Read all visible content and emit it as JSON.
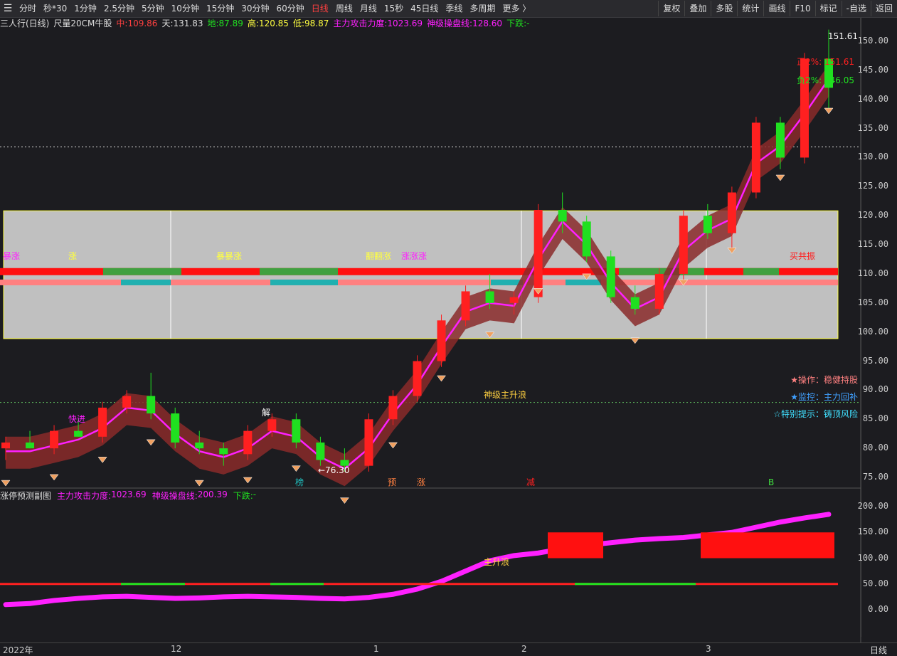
{
  "toolbar": {
    "items": [
      "分时",
      "秒*30",
      "1分钟",
      "2.5分钟",
      "5分钟",
      "10分钟",
      "15分钟",
      "30分钟",
      "60分钟",
      "日线",
      "周线",
      "月线",
      "15秒",
      "45日线",
      "季线",
      "多周期",
      "更多 〉"
    ],
    "active": "日线",
    "right_buttons": [
      "复权",
      "叠加",
      "多股",
      "统计",
      "画线",
      "F10",
      "标记",
      "-自选",
      "返回"
    ]
  },
  "info": {
    "title": "三人行(日线)",
    "indicator": "尺量20CM牛股",
    "mid_label": "中:",
    "mid": "109.86",
    "sky_label": "天:",
    "sky": "131.83",
    "ground_label": "地:",
    "ground": "87.89",
    "high_label": "高:",
    "high": "120.85",
    "low_label": "低:",
    "low": "98.87",
    "force_label": "主力攻击力度:",
    "force": "1023.69",
    "ctrl_label": "神级操盘线:",
    "ctrl": "128.60",
    "down_label": "下跌:",
    "down": "-"
  },
  "sub": {
    "title": "涨停预测副图",
    "force_label": "主力攻击力度:",
    "force": "1023.69",
    "ctrl_label": "神级操盘线:",
    "ctrl": "200.39",
    "down_label": "下跌:",
    "down": "-"
  },
  "notes": {
    "op": "★操作：稳健持股",
    "monitor": "★监控：主力回补",
    "tip": "☆特别提示：铸顶风险",
    "max_price": "151.61",
    "pos2": "正2%: 151.61",
    "neg2": "负2%: 146.05",
    "low_marker": "←76.30",
    "wave": "神级主升浪",
    "wave_sub": "主升浪",
    "timeframe": "日线"
  },
  "dates": [
    "2022年",
    "12",
    "1",
    "2",
    "3"
  ],
  "colors": {
    "up": "#ff2020",
    "down": "#20e020",
    "bg": "#1c1c20",
    "band": "#c0c0c0",
    "magenta": "#ff20ff"
  },
  "chart_data": {
    "type": "candlestick",
    "y_axis_main": {
      "ticks": [
        150,
        145,
        140,
        135,
        130,
        125,
        120,
        115,
        110,
        105,
        100,
        95,
        90,
        85,
        80,
        75
      ],
      "ylim": [
        73,
        153
      ]
    },
    "y_axis_sub": {
      "ticks": [
        200,
        150,
        100,
        50,
        0
      ]
    },
    "ohlc_sample": [
      {
        "o": 80,
        "h": 82,
        "l": 78,
        "c": 81
      },
      {
        "o": 81,
        "h": 83,
        "l": 80,
        "c": 80
      },
      {
        "o": 80,
        "h": 84,
        "l": 79,
        "c": 83
      },
      {
        "o": 83,
        "h": 85,
        "l": 82,
        "c": 82
      },
      {
        "o": 82,
        "h": 88,
        "l": 81,
        "c": 87
      },
      {
        "o": 87,
        "h": 90,
        "l": 86,
        "c": 89
      },
      {
        "o": 89,
        "h": 93,
        "l": 85,
        "c": 86
      },
      {
        "o": 86,
        "h": 87,
        "l": 80,
        "c": 81
      },
      {
        "o": 81,
        "h": 83,
        "l": 79,
        "c": 80
      },
      {
        "o": 80,
        "h": 81,
        "l": 77,
        "c": 79
      },
      {
        "o": 79,
        "h": 84,
        "l": 78,
        "c": 83
      },
      {
        "o": 83,
        "h": 86,
        "l": 82,
        "c": 85
      },
      {
        "o": 85,
        "h": 86,
        "l": 80,
        "c": 81
      },
      {
        "o": 81,
        "h": 82,
        "l": 77,
        "c": 78
      },
      {
        "o": 78,
        "h": 80,
        "l": 76,
        "c": 77
      },
      {
        "o": 77,
        "h": 86,
        "l": 76,
        "c": 85
      },
      {
        "o": 85,
        "h": 90,
        "l": 84,
        "c": 89
      },
      {
        "o": 89,
        "h": 96,
        "l": 88,
        "c": 95
      },
      {
        "o": 95,
        "h": 103,
        "l": 94,
        "c": 102
      },
      {
        "o": 102,
        "h": 108,
        "l": 101,
        "c": 107
      },
      {
        "o": 107,
        "h": 110,
        "l": 104,
        "c": 105
      },
      {
        "o": 105,
        "h": 107,
        "l": 103,
        "c": 106
      },
      {
        "o": 106,
        "h": 122,
        "l": 105,
        "c": 121
      },
      {
        "o": 121,
        "h": 124,
        "l": 117,
        "c": 119
      },
      {
        "o": 119,
        "h": 120,
        "l": 112,
        "c": 113
      },
      {
        "o": 113,
        "h": 114,
        "l": 105,
        "c": 106
      },
      {
        "o": 106,
        "h": 108,
        "l": 103,
        "c": 104
      },
      {
        "o": 104,
        "h": 111,
        "l": 103,
        "c": 110
      },
      {
        "o": 110,
        "h": 121,
        "l": 109,
        "c": 120
      },
      {
        "o": 120,
        "h": 122,
        "l": 116,
        "c": 117
      },
      {
        "o": 117,
        "h": 125,
        "l": 114,
        "c": 124
      },
      {
        "o": 124,
        "h": 137,
        "l": 123,
        "c": 136
      },
      {
        "o": 136,
        "h": 137,
        "l": 128,
        "c": 130
      },
      {
        "o": 130,
        "h": 148,
        "l": 129,
        "c": 147
      },
      {
        "o": 147,
        "h": 152,
        "l": 138,
        "c": 142
      }
    ],
    "annotations": [
      "暴涨",
      "涨",
      "暴暴涨",
      "涨涨涨",
      "翻翻涨",
      "买共振",
      "快进",
      "解",
      "榜",
      "预",
      "涨",
      "减",
      "B"
    ]
  }
}
